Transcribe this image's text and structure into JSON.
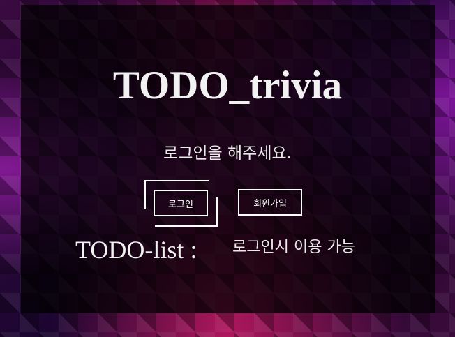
{
  "app": {
    "title": "TODO_trivia"
  },
  "auth": {
    "prompt": "로그인을 해주세요.",
    "login_label": "로그인",
    "signup_label": "회원가입"
  },
  "todo": {
    "label": "TODO-list :",
    "availability_note": "로그인시 이용 가능"
  },
  "colors": {
    "text": "#f2f2f2",
    "button_border": "#ffffff",
    "panel": "rgba(0,0,0,0.72)"
  }
}
